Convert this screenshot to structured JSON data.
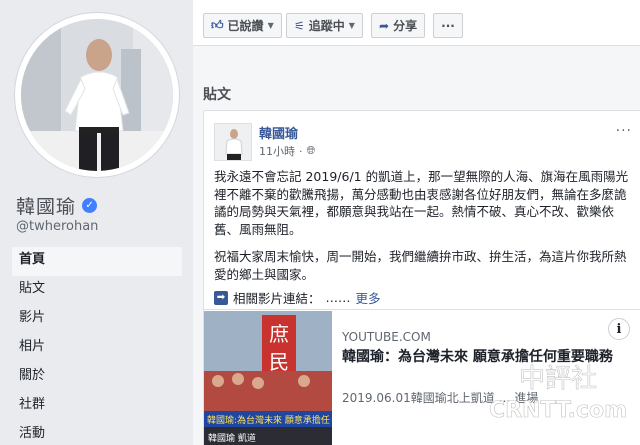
{
  "profile": {
    "name": "韓國瑜",
    "handle": "@twherohan"
  },
  "nav": {
    "items": [
      {
        "label": "首頁",
        "active": true
      },
      {
        "label": "貼文"
      },
      {
        "label": "影片"
      },
      {
        "label": "相片"
      },
      {
        "label": "關於"
      },
      {
        "label": "社群"
      },
      {
        "label": "活動"
      }
    ]
  },
  "actions": {
    "liked_label": "已說讚",
    "following_label": "追蹤中",
    "share_label": "分享",
    "more_label": "···"
  },
  "posts_section": {
    "title": "貼文"
  },
  "post": {
    "author": "韓國瑜",
    "time": "11小時",
    "more": "···",
    "paragraph1": "我永遠不會忘記 2019/6/1 的凱道上，那一望無際的人海、旗海在風雨陽光裡不離不棄的歡騰飛揚，萬分感動也由衷感謝各位好朋友們，無論在多麼詭譎的局勢與天氣裡，都願意與我站在一起。熱情不破、真心不改、歡樂依舊、風雨無阻。",
    "paragraph2": "祝福大家周末愉快，周一開始，我們繼續拚市政、拚生活，為這片你我所熱愛的鄉土與國家。",
    "related_label": "相關影片連結：",
    "ellipsis": "……",
    "see_more": "更多"
  },
  "link_preview": {
    "source": "YOUTUBE.COM",
    "title": "韓國瑜：為台灣未來 願意承擔任何重要職務",
    "description": "2019.06.01韓國瑜北上凱道 … 進場",
    "thumb_text_1": "庶",
    "thumb_text_2": "民",
    "thumb_banner": "韓國瑜:為台灣未來 願意承擔任",
    "thumb_caption": "韓國瑜 凱道",
    "info_icon": "i"
  },
  "watermark": {
    "line1": "中評社",
    "line2": "CRNTT.com"
  },
  "colors": {
    "fb_blue": "#385898",
    "verified_blue": "#4080ff",
    "page_bg": "#e9ebee"
  },
  "icons": [
    "like-icon",
    "rss-follow-icon",
    "share-icon",
    "globe-icon",
    "arrow-right-icon",
    "info-icon",
    "verified-check-icon"
  ]
}
